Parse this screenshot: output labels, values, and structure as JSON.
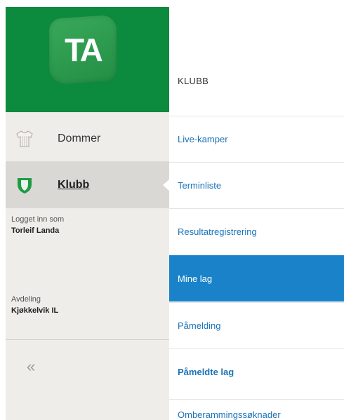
{
  "logo": {
    "text": "TA",
    "brand_color": "#0c8a3d"
  },
  "sidebar": {
    "items": [
      {
        "label": "Dommer",
        "icon": "shirt-icon",
        "active": false
      },
      {
        "label": "Klubb",
        "icon": "shield-icon",
        "active": true
      }
    ],
    "logged_in_label": "Logget inn som",
    "logged_in_value": "Torleif Landa",
    "department_label": "Avdeling",
    "department_value": "Kjøkkelvik IL",
    "collapse_symbol": "«",
    "collapse_icon": "double-chevron-left-icon"
  },
  "menu": {
    "header": "KLUBB",
    "accent_color": "#1a82c8",
    "link_color": "#1a73b8",
    "items": [
      {
        "label": "Live-kamper",
        "active": false
      },
      {
        "label": "Terminliste",
        "active": false
      },
      {
        "label": "Resultatregistrering",
        "active": false
      },
      {
        "label": "Mine lag",
        "active": true
      },
      {
        "label": "Påmelding",
        "active": false
      },
      {
        "label": "Påmeldte lag",
        "active": false
      },
      {
        "label": "Omberammingssøknader",
        "active": false
      }
    ]
  }
}
